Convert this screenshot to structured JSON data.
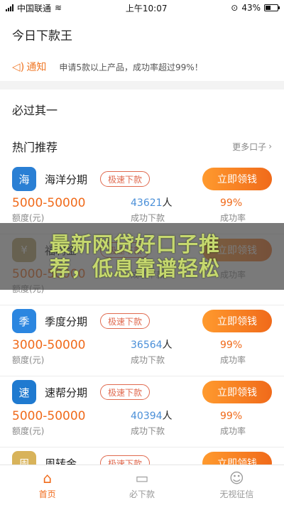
{
  "status_bar": {
    "carrier": "中国联通",
    "time": "上午10:07",
    "battery": "43%"
  },
  "header": {
    "title": "今日下款王"
  },
  "notice": {
    "label": "通知",
    "text": "申请5款以上产品，成功率超过99%！"
  },
  "sections": {
    "must_pass": "必过其一",
    "hot": "热门推荐",
    "more": "更多口子"
  },
  "loans": [
    {
      "name": "海洋分期",
      "badge": "极速下款",
      "button": "立即领钱",
      "amount": "5000-50000",
      "amount_label": "额度(元)",
      "apps": "43621",
      "apps_unit": "人",
      "apps_label": "成功下款",
      "rate": "99%",
      "rate_label": "成功率",
      "logo_color": "#2a7fd4",
      "logo_glyph": "海"
    },
    {
      "name": "福利金",
      "badge": "极速下款",
      "button": "立即领钱",
      "amount": "5000-50000",
      "amount_label": "额度(元)",
      "apps": "",
      "apps_unit": "",
      "apps_label": "成功下款",
      "rate": "",
      "rate_label": "成功率",
      "logo_color": "#b9a46a",
      "logo_glyph": "¥"
    },
    {
      "name": "季度分期",
      "badge": "极速下款",
      "button": "立即领钱",
      "amount": "3000-50000",
      "amount_label": "额度(元)",
      "apps": "36564",
      "apps_unit": "人",
      "apps_label": "成功下款",
      "rate": "99%",
      "rate_label": "成功率",
      "logo_color": "#2b86e0",
      "logo_glyph": "季"
    },
    {
      "name": "速帮分期",
      "badge": "极速下款",
      "button": "立即领钱",
      "amount": "5000-50000",
      "amount_label": "额度(元)",
      "apps": "40394",
      "apps_unit": "人",
      "apps_label": "成功下款",
      "rate": "99%",
      "rate_label": "成功率",
      "logo_color": "#1f7ad0",
      "logo_glyph": "速"
    },
    {
      "name": "周转金",
      "badge": "极速下款",
      "button": "立即领钱",
      "amount": "",
      "amount_label": "",
      "apps": "",
      "apps_unit": "",
      "apps_label": "",
      "rate": "",
      "rate_label": "",
      "logo_color": "#d8b35a",
      "logo_glyph": "周"
    }
  ],
  "overlay": {
    "line1": "最新网贷好口子推",
    "line2": "荐，低息靠谱轻松"
  },
  "tabs": [
    {
      "label": "首页",
      "icon": "home-icon",
      "glyph": "⌂"
    },
    {
      "label": "必下款",
      "icon": "wallet-icon",
      "glyph": "▭"
    },
    {
      "label": "无视征信",
      "icon": "user-icon",
      "glyph": "☺"
    }
  ]
}
